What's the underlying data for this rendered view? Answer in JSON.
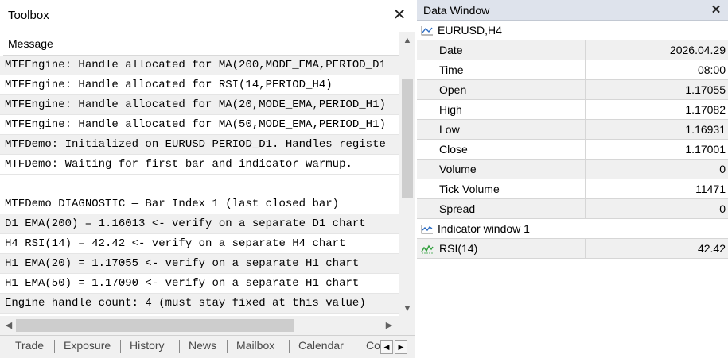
{
  "toolbox": {
    "title": "Toolbox",
    "column_header": "Message",
    "messages": [
      "MTFEngine: Handle allocated for MA(200,MODE_EMA,PERIOD_D1",
      "MTFEngine: Handle allocated for RSI(14,PERIOD_H4)",
      "MTFEngine: Handle allocated for MA(20,MODE_EMA,PERIOD_H1)",
      "MTFEngine: Handle allocated for MA(50,MODE_EMA,PERIOD_H1)",
      "MTFDemo: Initialized on EURUSD PERIOD_D1. Handles registe",
      "MTFDemo: Waiting for first bar and indicator warmup.",
      "",
      "MTFDemo DIAGNOSTIC — Bar Index 1 (last closed bar)",
      "D1 EMA(200)  = 1.16013  <- verify on a separate D1 chart",
      "H4 RSI(14)   = 42.42  <- verify on a separate H4 chart",
      "H1 EMA(20)  = 1.17055  <- verify on a separate H1 chart",
      "H1 EMA(50)  = 1.17090  <- verify on a separate H1 chart",
      "Engine handle count: 4 (must stay fixed at this value)"
    ],
    "tabs": [
      "Trade",
      "Exposure",
      "History",
      "News",
      "Mailbox",
      "Calendar",
      "Co"
    ]
  },
  "data_window": {
    "title": "Data Window",
    "symbol_group": "EURUSD,H4",
    "rows": [
      {
        "label": "Date",
        "value": "2026.04.29"
      },
      {
        "label": "Time",
        "value": "08:00"
      },
      {
        "label": "Open",
        "value": "1.17055"
      },
      {
        "label": "High",
        "value": "1.17082"
      },
      {
        "label": "Low",
        "value": "1.16931"
      },
      {
        "label": "Close",
        "value": "1.17001"
      },
      {
        "label": "Volume",
        "value": "0"
      },
      {
        "label": "Tick Volume",
        "value": "11471"
      },
      {
        "label": "Spread",
        "value": "0"
      }
    ],
    "indicator_group": "Indicator window 1",
    "indicator_rows": [
      {
        "label": "RSI(14)",
        "value": "42.42"
      }
    ]
  },
  "icons": {
    "close": "close-icon",
    "scroll_up": "scroll-up-icon",
    "scroll_down": "scroll-down-icon",
    "scroll_left": "scroll-left-icon",
    "scroll_right": "scroll-right-icon",
    "chart_line": "chart-line-icon",
    "indicator": "indicator-icon"
  },
  "colors": {
    "data_window_title_bg": "#dee3ec",
    "row_alt_bg": "#f0f0f0",
    "chart_icon_blue": "#2b6cc4",
    "indicator_icon_green": "#2e9e3a"
  }
}
